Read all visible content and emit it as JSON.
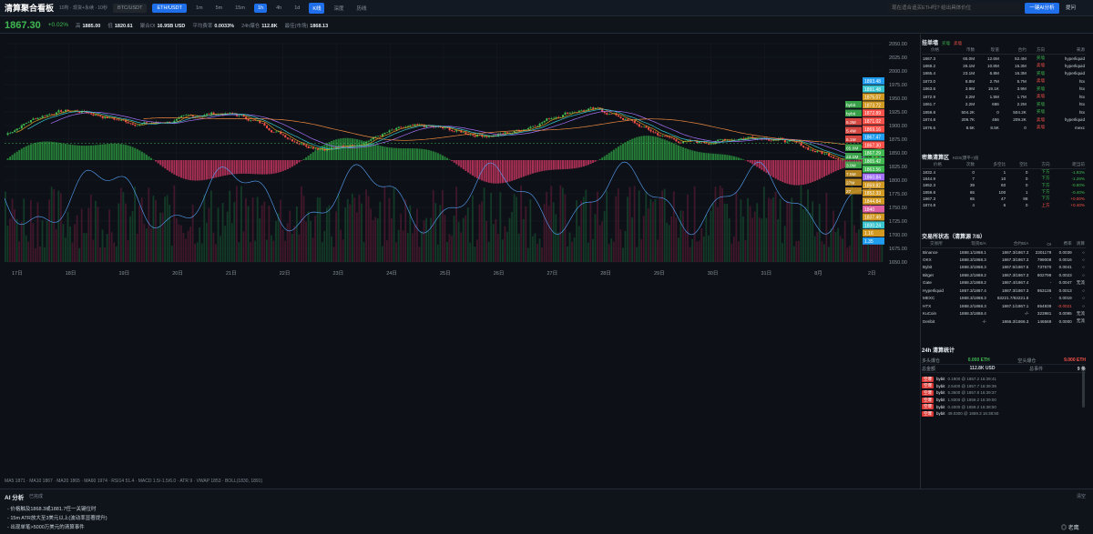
{
  "app": {
    "title": "清算聚合看板",
    "subtitle": "10所 · 现货+永续 · 10秒",
    "symbols": [
      "BTC/USDT",
      "ETH/USDT"
    ],
    "active_symbol": 1,
    "timeframes": [
      "1m",
      "5m",
      "15m",
      "1h",
      "4h",
      "1d"
    ],
    "active_tf": 3,
    "views": [
      "K线",
      "深度",
      "历线"
    ],
    "active_view": 0,
    "ask_placeholder": "现在适合追买ETH吗? 给出具体价位",
    "ai_button": "一键AI分析",
    "ask_button": "提问"
  },
  "stats": {
    "price": "1867.30",
    "change": "+0.02%",
    "items": [
      {
        "k": "高",
        "v": "1885.00"
      },
      {
        "k": "低",
        "v": "1820.61"
      },
      {
        "k": "聚合OI",
        "v": "16.95B USD"
      },
      {
        "k": "平均费率",
        "v": "0.0033%"
      },
      {
        "k": "24h爆仓",
        "v": "112.8K"
      },
      {
        "k": "最佳(市场)",
        "v": "1868.13"
      }
    ]
  },
  "chart_data": {
    "type": "line",
    "x_labels": [
      "17日",
      "18日",
      "19日",
      "20日",
      "21日",
      "22日",
      "23日",
      "24日",
      "25日",
      "26日",
      "27日",
      "28日",
      "29日",
      "30日",
      "31日",
      "8月",
      "2日"
    ],
    "y_ticks": [
      "2050.00",
      "2025.00",
      "2000.00",
      "1975.00",
      "1950.00",
      "1925.00",
      "1900.00",
      "1875.00",
      "1850.00",
      "1825.00",
      "1800.00",
      "1775.00",
      "1750.00",
      "1725.00",
      "1700.00",
      "1675.00",
      "1650.00"
    ],
    "ylim": [
      1650,
      2050
    ],
    "price_tags": [
      {
        "v": "1893.48",
        "c": "#1f9cf0"
      },
      {
        "v": "1891.48",
        "c": "#39c5cf"
      },
      {
        "v": "1875.07",
        "c": "#d29922"
      },
      {
        "v": "1873.72",
        "c": "#d29922"
      },
      {
        "v": "1872.89",
        "c": "#f85149"
      },
      {
        "v": "1871.02",
        "c": "#f85149"
      },
      {
        "v": "1869.16",
        "c": "#f85149"
      },
      {
        "v": "1867.47",
        "c": "#1f9cf0"
      },
      {
        "v": "1867.30",
        "c": "#f85149"
      },
      {
        "v": "1867.29",
        "c": "#3fb950"
      },
      {
        "v": "1865.42",
        "c": "#3fb950"
      },
      {
        "v": "1863.56",
        "c": "#3fb950"
      },
      {
        "v": "1860.84",
        "c": "#a371f7"
      },
      {
        "v": "1859.82",
        "c": "#d29922"
      },
      {
        "v": "1852.33",
        "c": "#d29922"
      },
      {
        "v": "1844.84",
        "c": "#d29922"
      },
      {
        "v": "1840",
        "c": "#db61a2"
      },
      {
        "v": "1837.49",
        "c": "#d29922"
      },
      {
        "v": "1830.24",
        "c": "#39c5cf"
      },
      {
        "v": "1.16",
        "c": "#d29922"
      },
      {
        "v": "1.35",
        "c": "#1f9cf0"
      }
    ],
    "labels_left": [
      {
        "t": "bybit",
        "c": "#3fb950"
      },
      {
        "t": "bybit",
        "c": "#3fb950"
      },
      {
        "t": "5.3M",
        "c": "#f85149"
      },
      {
        "t": "5.4M",
        "c": "#f85149"
      },
      {
        "t": "6.1M",
        "c": "#f85149"
      },
      {
        "t": "65.0M",
        "c": "#3fb950"
      },
      {
        "t": "23.1M",
        "c": "#3fb950"
      },
      {
        "t": "3.9M",
        "c": "#3fb950"
      },
      {
        "t": "7.5M",
        "c": "#d29922"
      },
      {
        "t": "27M",
        "c": "#d29922"
      },
      {
        "t": "27",
        "c": "#d29922"
      }
    ]
  },
  "indicator_line": "MA5 1871 · MA10 1867 · MA20 1865 · MA60 1974 · RSI14 51.4 · MACD 1.5/-1.5/6.0 · ATR 9 · VWAP 1853 · BOLL(1830, 1891)",
  "orderbook": {
    "title": "挂单墙",
    "legend": [
      "买墙",
      "卖墙"
    ],
    "headers": [
      "价格",
      "币数",
      "现值",
      "合约",
      "方向",
      "来源"
    ],
    "rows": [
      [
        "1867.3",
        "65.0M",
        "12.6M",
        "52.4M",
        "买墙",
        "hyperliquid"
      ],
      [
        "1869.2",
        "26.1M",
        "10.8M",
        "15.3M",
        "卖墙",
        "hyperliquid"
      ],
      [
        "1865.4",
        "23.1M",
        "6.8M",
        "16.3M",
        "买墙",
        "hyperliquid"
      ],
      [
        "1873.0",
        "8.8M",
        "2.7M",
        "5.7M",
        "卖墙",
        "htx"
      ],
      [
        "1863.6",
        "3.9M",
        "19.1K",
        "3.9M",
        "买墙",
        "htx"
      ],
      [
        "1872.9",
        "3.2M",
        "1.5M",
        "1.7M",
        "卖墙",
        "htx"
      ],
      [
        "1861.7",
        "2.2M",
        "686",
        "2.2M",
        "买墙",
        "htx"
      ],
      [
        "1859.8",
        "504.2K",
        "0",
        "504.2K",
        "买墙",
        "htx"
      ],
      [
        "1874.8",
        "209.7K",
        "456",
        "209.2K",
        "卖墙",
        "hyperliquid"
      ],
      [
        "1876.6",
        "8.5K",
        "8.5K",
        "0",
        "卖墙",
        "mexc"
      ]
    ]
  },
  "liq_zone": {
    "title": "密集清算区",
    "note": "KDS(爆平+)值",
    "headers": [
      "价格",
      "次数",
      "多空比",
      "空比",
      "方向",
      "距当前"
    ],
    "rows": [
      [
        "1832.4",
        "0",
        "1",
        "0",
        "下方",
        "-1.93%"
      ],
      [
        "1844.9",
        "7",
        "10",
        "0",
        "下方",
        "-1.26%"
      ],
      [
        "1852.3",
        "39",
        "60",
        "0",
        "下方",
        "-0.80%"
      ],
      [
        "1859.8",
        "65",
        "100",
        "1",
        "下方",
        "-0.40%"
      ],
      [
        "1867.3",
        "65",
        "47",
        "98",
        "下方",
        "+0.00%"
      ],
      [
        "1874.8",
        "4",
        "6",
        "0",
        "上方",
        "+0.40%"
      ]
    ]
  },
  "exchanges": {
    "title": "交易所状态（清算源 7/8）",
    "headers": [
      "交易所",
      "现货B/A",
      "合约B/A",
      "OI",
      "费率",
      "清算"
    ],
    "rows": [
      [
        "Binance",
        "1868.1/1868.1",
        "1867.3/1867.3",
        "2301179",
        "0.0039",
        "○"
      ],
      [
        "OKX",
        "1868.3/1868.3",
        "1867.3/1867.3",
        "799008",
        "0.0016",
        "○"
      ],
      [
        "Bybit",
        "1868.3/1868.3",
        "1867.5/1867.5",
        "737570",
        "0.0041",
        "○"
      ],
      [
        "Bitget",
        "1868.2/1868.2",
        "1867.3/1867.3",
        "802799",
        "0.0023",
        "○"
      ],
      [
        "Gate",
        "1868.2/1868.2",
        "1867.4/1867.4",
        "-",
        "0.0047",
        "无流"
      ],
      [
        "Hyperliquid",
        "1867.3/1867.4",
        "1867.3/1867.3",
        "953136",
        "0.0013",
        "○"
      ],
      [
        "MEXC",
        "1868.3/1868.3",
        "63221.7/63221.8",
        "-",
        "0.0019",
        "○"
      ],
      [
        "HTX",
        "1868.2/1868.3",
        "1867.1/1867.1",
        "654939",
        "-0.0021",
        "○"
      ],
      [
        "KuCoin",
        "1868.3/1868.4",
        "-/-",
        "323981",
        "0.0095",
        "无流"
      ],
      [
        "Deribit",
        "-/-",
        "1866.3/1866.3",
        "146569",
        "0.0000",
        "无流"
      ]
    ]
  },
  "liq24": {
    "title": "24h 清算统计",
    "long_k": "多头爆仓",
    "long_v": "0.000 ETH",
    "short_k": "空头爆仓",
    "short_v": "9.000 ETH",
    "total_k": "总金额",
    "total_v": "112.8K USD",
    "count_k": "总事件",
    "count_v": "9 条",
    "events": [
      {
        "tag": "空爆",
        "src": "bybit",
        "t": "0.1900 @ 1857.2  16:39:41"
      },
      {
        "tag": "空爆",
        "src": "bybit",
        "t": "2.5400 @ 1857.7  16:39:39"
      },
      {
        "tag": "空爆",
        "src": "bybit",
        "t": "5.3600 @ 1857.8  16:39:37"
      },
      {
        "tag": "空爆",
        "src": "bybit",
        "t": "1.9300 @ 1859.2  16:39:00"
      },
      {
        "tag": "空爆",
        "src": "bybit",
        "t": "0.4000 @ 1859.2  16:38:50"
      },
      {
        "tag": "空爆",
        "src": "bybit",
        "t": "49.0300 @ 1859.3  16:38:50"
      }
    ]
  },
  "ai": {
    "title": "AI 分析",
    "sub": "已完成",
    "close": "清空",
    "lines": [
      "- 价格触及1868.3或1881.7任一关键位时",
      "- 15m ATR放大至3美元以上(波动率显著提升)",
      "- 出现单笔>5000万美元的清算事件"
    ]
  },
  "badge": "◎ 老鹰"
}
